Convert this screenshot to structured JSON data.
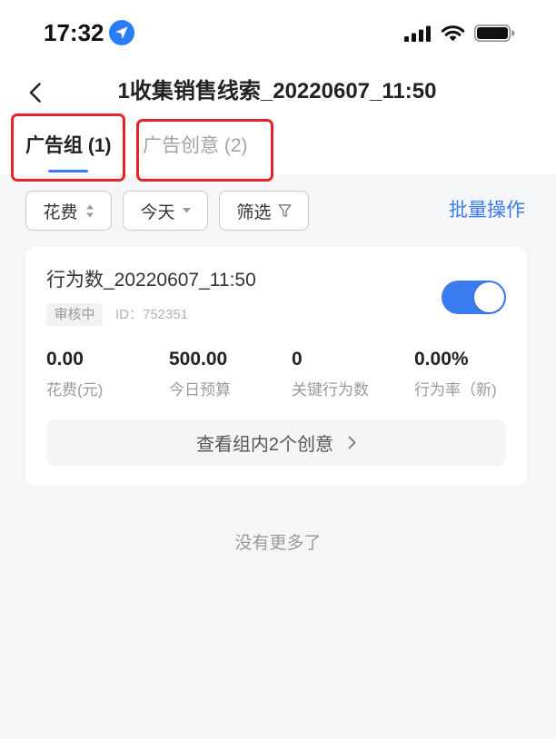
{
  "status_bar": {
    "time": "17:32",
    "location_icon": "location-arrow-icon",
    "signal_icon": "cellular-signal-icon",
    "wifi_icon": "wifi-icon",
    "battery_icon": "battery-icon"
  },
  "nav": {
    "back_icon": "chevron-left-icon",
    "title": "1收集销售线索_20220607_11:50"
  },
  "tabs": [
    {
      "label": "广告组 (1)",
      "active": true
    },
    {
      "label": "广告创意 (2)",
      "active": false
    }
  ],
  "filters": {
    "sort": {
      "label": "花费",
      "icon": "sort-up-down-icon"
    },
    "date_range": {
      "label": "今天",
      "icon": "caret-down-icon"
    },
    "filter": {
      "label": "筛选",
      "icon": "funnel-icon"
    },
    "batch_action_label": "批量操作"
  },
  "ad_group": {
    "name": "行为数_20220607_11:50",
    "status_badge": "审核中",
    "id_text": "ID：752351",
    "enabled": true,
    "stats": [
      {
        "value": "0.00",
        "label": "花费(元)"
      },
      {
        "value": "500.00",
        "label": "今日预算"
      },
      {
        "value": "0",
        "label": "关键行为数"
      },
      {
        "value": "0.00%",
        "label": "行为率（新)"
      }
    ],
    "view_creatives": {
      "label": "查看组内2个创意",
      "icon": "chevron-right-icon"
    }
  },
  "list_footer": {
    "end_text": "没有更多了"
  },
  "colors": {
    "accent": "#3a7bf0",
    "annotation_red": "#e5232a",
    "page_background": "#f5f6f8",
    "location_blue": "#2b7cf7"
  }
}
